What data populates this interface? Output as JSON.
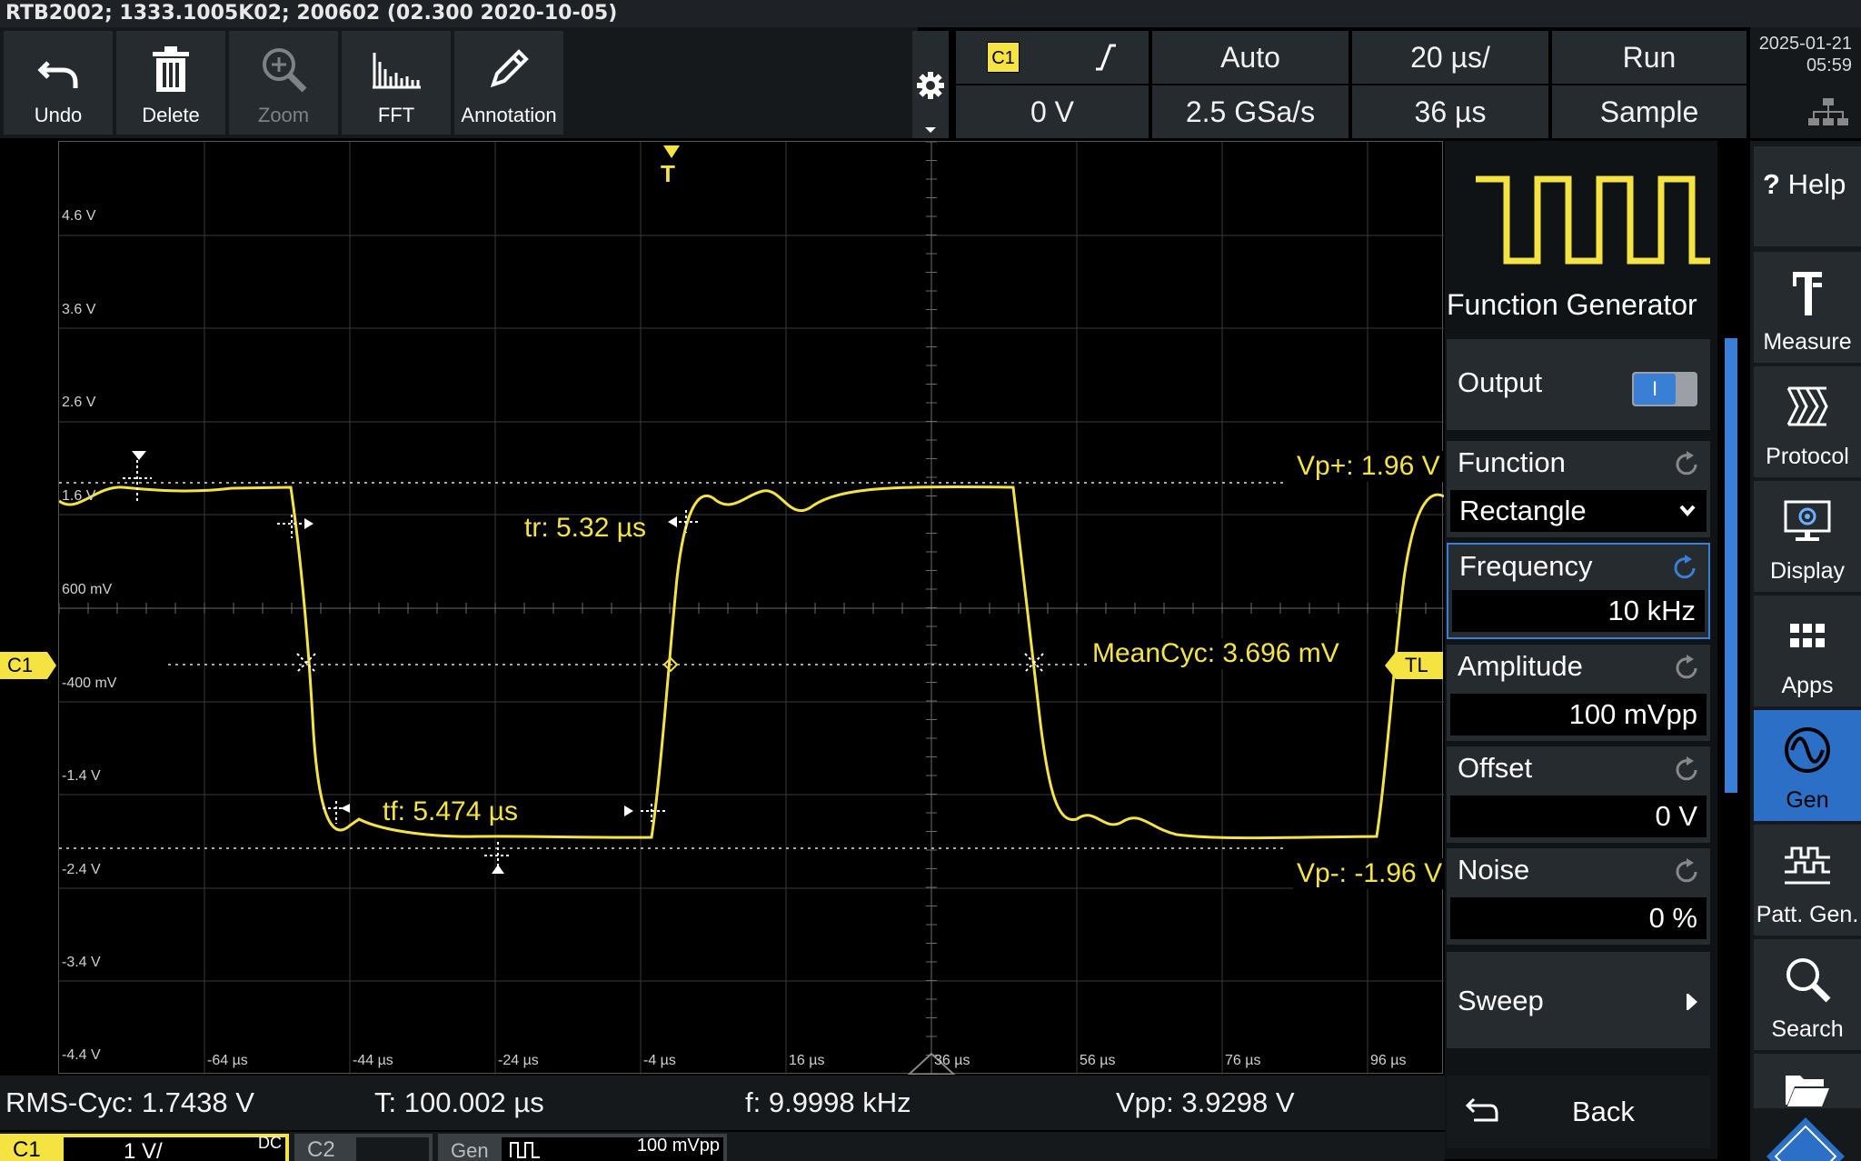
{
  "info_bar": {
    "text": "RTB2002; 1333.1005K02; 200602 (02.300 2020-10-05)"
  },
  "toolbar": {
    "undo": "Undo",
    "delete": "Delete",
    "zoom": "Zoom",
    "fft": "FFT",
    "annotation": "Annotation"
  },
  "acquisition": {
    "channel_badge": "C1",
    "trigger_mode": "Auto",
    "time_scale": "20 µs/",
    "run_state": "Run",
    "trigger_level": "0 V",
    "sample_rate": "2.5 GSa/s",
    "horizontal_position": "36 µs",
    "acq_mode": "Sample",
    "date": "2025-01-21",
    "time": "05:59"
  },
  "plot": {
    "y_labels": [
      "4.6 V",
      "3.6 V",
      "2.6 V",
      "1.6 V",
      "600 mV",
      "-400 mV",
      "-1.4 V",
      "-2.4 V",
      "-3.4 V",
      "-4.4 V"
    ],
    "x_labels": [
      "-64 µs",
      "-44 µs",
      "-24 µs",
      "-4 µs",
      "16 µs",
      "36 µs",
      "56 µs",
      "76 µs",
      "96 µs"
    ],
    "trigger_marker": "T",
    "channel_marker": "C1",
    "trigger_level_marker": "TL",
    "measurements": {
      "vp_plus": "Vp+: 1.96 V",
      "vp_minus": "Vp-: -1.96 V",
      "rise_time": "tr: 5.32 µs",
      "fall_time": "tf: 5.474 µs",
      "mean_cycle": "MeanCyc: 3.696 mV"
    }
  },
  "status": {
    "rms": "RMS-Cyc: 1.7438 V",
    "period": "T: 100.002 µs",
    "frequency": "f: 9.9998 kHz",
    "vpp": "Vpp: 3.9298 V"
  },
  "channel_bar": {
    "c1": "C1",
    "c1_scale": "1 V/",
    "c1_coupling": "DC",
    "c2": "C2",
    "gen": "Gen",
    "gen_amp": "100 mVpp"
  },
  "function_generator": {
    "title": "Function Generator",
    "output_label": "Output",
    "output_toggle": "I",
    "function_label": "Function",
    "function_value": "Rectangle",
    "frequency_label": "Frequency",
    "frequency_value": "10 kHz",
    "amplitude_label": "Amplitude",
    "amplitude_value": "100 mVpp",
    "offset_label": "Offset",
    "offset_value": "0 V",
    "noise_label": "Noise",
    "noise_value": "0 %",
    "sweep_label": "Sweep",
    "back_label": "Back"
  },
  "right_nav": {
    "help": "Help",
    "help_glyph": "?",
    "measure": "Measure",
    "protocol": "Protocol",
    "display": "Display",
    "apps": "Apps",
    "gen": "Gen",
    "patt_gen": "Patt. Gen.",
    "search": "Search"
  },
  "colors": {
    "trace": "#f5e342",
    "active": "#2b6fc7",
    "panel": "#262b30"
  }
}
